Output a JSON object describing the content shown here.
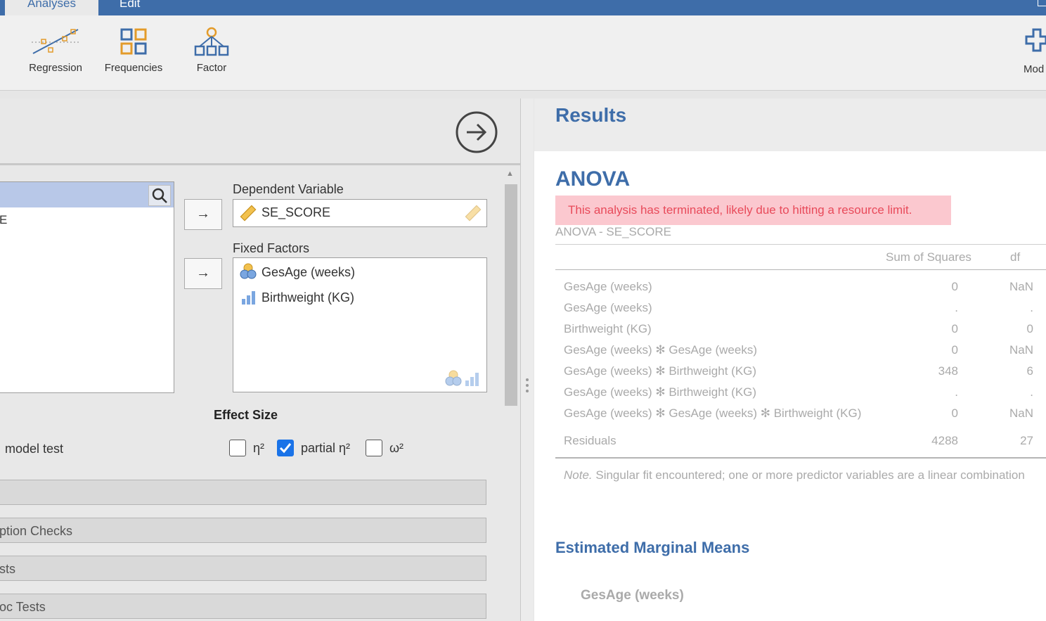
{
  "tabs": {
    "analyses": "Analyses",
    "edit": "Edit"
  },
  "ribbon": {
    "regression": "Regression",
    "frequencies": "Frequencies",
    "factor": "Factor",
    "modules": "Mod"
  },
  "left": {
    "var_item": "E",
    "dependent_label": "Dependent Variable",
    "dependent_value": "SE_SCORE",
    "fixed_label": "Fixed Factors",
    "fixed_items": [
      "GesAge (weeks)",
      "Birthweight (KG)"
    ],
    "model_test": "model test",
    "effect_size": {
      "title": "Effect Size",
      "eta": "η²",
      "partial_eta": "partial η²",
      "omega": "ω²",
      "eta_checked": false,
      "partial_checked": true,
      "omega_checked": false
    },
    "sections": [
      "",
      "ption Checks",
      "sts",
      "oc Tests"
    ],
    "arrow": "→"
  },
  "results": {
    "title": "Results",
    "anova_title": "ANOVA",
    "error": "This analysis has terminated, likely due to hitting a resource limit.",
    "caption": "ANOVA - SE_SCORE",
    "headers": {
      "ss": "Sum of Squares",
      "df": "df"
    },
    "rows": [
      {
        "term": "GesAge (weeks)",
        "ss": "0",
        "df": "NaN"
      },
      {
        "term": "GesAge (weeks)",
        "ss": ".",
        "df": "."
      },
      {
        "term": "Birthweight (KG)",
        "ss": "0",
        "df": "0"
      },
      {
        "term": "GesAge (weeks) ✻ GesAge (weeks)",
        "ss": "0",
        "df": "NaN"
      },
      {
        "term": "GesAge (weeks) ✻ Birthweight (KG)",
        "ss": "348",
        "df": "6"
      },
      {
        "term": "GesAge (weeks) ✻ Birthweight (KG)",
        "ss": ".",
        "df": "."
      },
      {
        "term": "GesAge (weeks) ✻ GesAge (weeks) ✻ Birthweight (KG)",
        "ss": "0",
        "df": "NaN"
      },
      {
        "term": "Residuals",
        "ss": "4288",
        "df": "27"
      }
    ],
    "note_label": "Note.",
    "note_text": " Singular fit encountered; one or more predictor variables are a linear combination",
    "emm_title": "Estimated Marginal Means",
    "emm_sub": "GesAge (weeks)"
  },
  "colors": {
    "accent": "#3e6da9",
    "error_bg": "#fbc8cf",
    "error_text": "#e84a5a"
  }
}
